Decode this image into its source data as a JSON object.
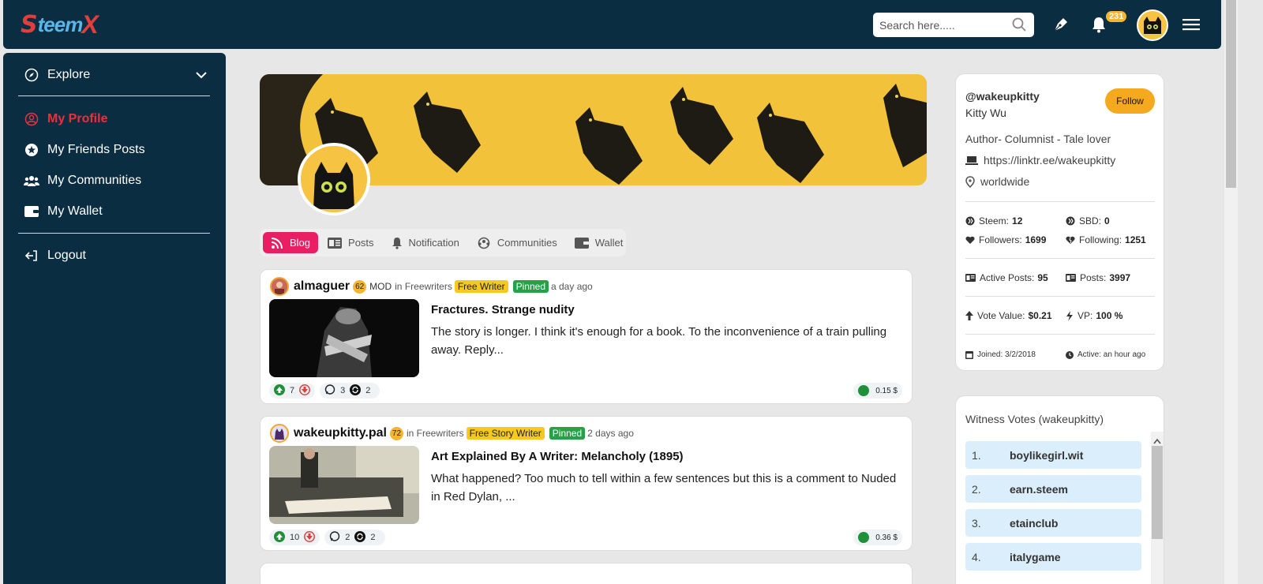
{
  "app": {
    "logo_s": "S",
    "logo_text": "teem",
    "logo_x": "X"
  },
  "topbar": {
    "search_placeholder": "Search here.....",
    "notification_count": "231"
  },
  "sidebar": {
    "explore": "Explore",
    "items": [
      {
        "label": "My Profile",
        "active": true
      },
      {
        "label": "My Friends Posts"
      },
      {
        "label": "My Communities"
      },
      {
        "label": "My Wallet"
      }
    ],
    "logout": "Logout"
  },
  "tabs": [
    {
      "label": "Blog",
      "active": true
    },
    {
      "label": "Posts"
    },
    {
      "label": "Notification"
    },
    {
      "label": "Communities"
    },
    {
      "label": "Wallet"
    }
  ],
  "posts": [
    {
      "author": "almaguer",
      "reputation": "62",
      "role": "MOD",
      "in_text": "in Freewriters",
      "role_tag": "Free Writer",
      "pinned": "Pinned",
      "time": "a day ago",
      "title": "Fractures. Strange nudity",
      "body": "The story is longer. I think it's enough for a book. To the inconvenience of a train pulling away. Reply...",
      "upvotes": "7",
      "comments": "3",
      "reblogs": "2",
      "payout": "0.15 $"
    },
    {
      "author": "wakeupkitty.pal",
      "reputation": "72",
      "role": "",
      "in_text": "in Freewriters",
      "role_tag": "Free Story Writer",
      "pinned": "Pinned",
      "time": "2 days ago",
      "title": "Art Explained By A Writer: Melancholy (1895)",
      "body": "What happened? Too much to tell within a few sentences but this is a comment to Nuded in Red Dylan, ...",
      "upvotes": "10",
      "comments": "2",
      "reblogs": "2",
      "payout": "0.36 $"
    }
  ],
  "profile": {
    "handle": "@wakeupkitty",
    "name": "Kitty Wu",
    "follow_label": "Follow",
    "about": "Author- Columnist - Tale lover",
    "website": "https://linktr.ee/wakeupkitty",
    "location": "worldwide",
    "steem_label": "Steem:",
    "steem": "12",
    "sbd_label": "SBD:",
    "sbd": "0",
    "followers_label": "Followers:",
    "followers": "1699",
    "following_label": "Following:",
    "following": "1251",
    "active_posts_label": "Active Posts:",
    "active_posts": "95",
    "posts_label": "Posts:",
    "posts": "3997",
    "vote_value_label": "Vote Value:",
    "vote_value": "$0.21",
    "vp_label": "VP:",
    "vp": "100 %",
    "joined": "Joined: 3/2/2018",
    "active": "Active: an hour ago"
  },
  "witness": {
    "title": "Witness Votes (wakeupkitty)",
    "items": [
      {
        "num": "1.",
        "name": "boylikegirl.wit"
      },
      {
        "num": "2.",
        "name": "earn.steem"
      },
      {
        "num": "3.",
        "name": "etainclub"
      },
      {
        "num": "4.",
        "name": "italygame"
      }
    ]
  },
  "colors": {
    "nav_bg": "#0b2d42",
    "accent_red": "#e8313c",
    "blog_pink": "#ea1f63",
    "follow_orange": "#f5a91e",
    "tag_yellow": "#f7c81e",
    "tag_green": "#27a046"
  }
}
